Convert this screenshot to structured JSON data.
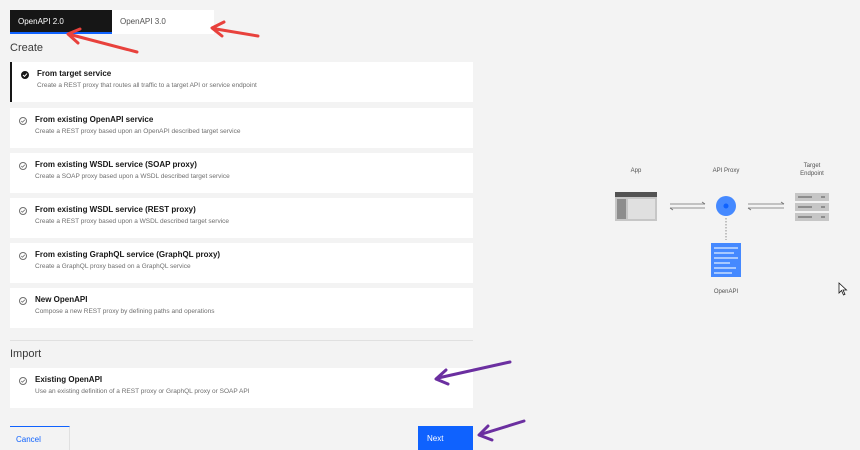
{
  "tabs": [
    {
      "label": "OpenAPI 2.0"
    },
    {
      "label": "OpenAPI 3.0"
    }
  ],
  "create": {
    "heading": "Create",
    "cards": [
      {
        "title": "From target service",
        "desc": "Create a REST proxy that routes all traffic to a target API or service endpoint"
      },
      {
        "title": "From existing OpenAPI service",
        "desc": "Create a REST proxy based upon an OpenAPI described target service"
      },
      {
        "title": "From existing WSDL service (SOAP proxy)",
        "desc": "Create a SOAP proxy based upon a WSDL described target service"
      },
      {
        "title": "From existing WSDL service (REST proxy)",
        "desc": "Create a REST proxy based upon a WSDL described target service"
      },
      {
        "title": "From existing GraphQL service (GraphQL proxy)",
        "desc": "Create a GraphQL proxy based on a GraphQL service"
      },
      {
        "title": "New OpenAPI",
        "desc": "Compose a new REST proxy by defining paths and operations"
      }
    ]
  },
  "import": {
    "heading": "Import",
    "cards": [
      {
        "title": "Existing OpenAPI",
        "desc": "Use an existing definition of a REST proxy or GraphQL proxy or SOAP API"
      }
    ]
  },
  "footer": {
    "cancel_label": "Cancel",
    "next_label": "Next"
  },
  "diagram": {
    "app_label": "App",
    "proxy_label": "API Proxy",
    "target_label_line1": "Target",
    "target_label_line2": "Endpoint",
    "openapi_label": "OpenAPI"
  },
  "colors": {
    "accent": "#0f62fe",
    "selected_tab_bg": "#161616",
    "annotation_red": "#e8413c",
    "annotation_purple": "#6b2fa0",
    "diagram_blue": "#4589ff"
  }
}
